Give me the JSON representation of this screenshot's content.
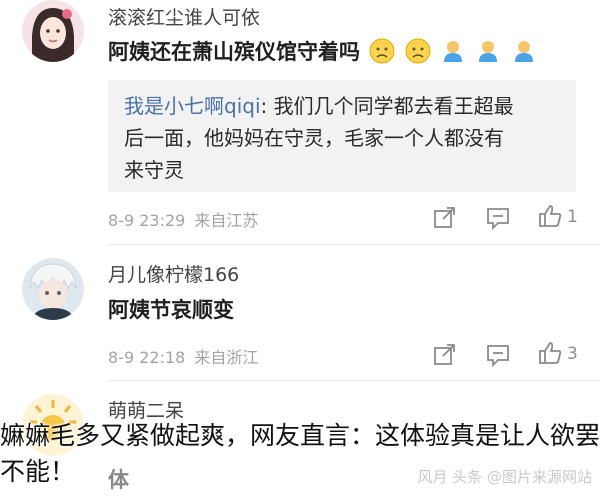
{
  "comments": [
    {
      "username": "滚滚红尘谁人可依",
      "content": "阿姨还在萧山殡仪馆守着吗",
      "emojis": [
        "sad-face",
        "sad-face",
        "person",
        "person",
        "person"
      ],
      "reply": {
        "author": "我是小七啊qiqi",
        "line1": ": 我们几个同学都去看王超最",
        "line2": "后一面，他妈妈在守灵，毛家一个人都没有",
        "line3": "来守灵"
      },
      "datetime": "8-9 23:29",
      "source": "来自江苏",
      "likes": "1"
    },
    {
      "username": "月儿像柠檬166",
      "content": "阿姨节哀顺变",
      "datetime": "8-9 22:18",
      "source": "来自浙江",
      "likes": "3"
    },
    {
      "username": "萌萌二呆",
      "content": "体"
    }
  ],
  "caption": "嫲嫲毛多又紧做起爽，网友直言：这体验真是让人欲罢不能！",
  "watermark": "风月 头条 @图片来源网站",
  "colors": {
    "reply_author": "#4a72a8",
    "meta": "#a3a3a3",
    "reply_bg": "#f2f2f2"
  }
}
